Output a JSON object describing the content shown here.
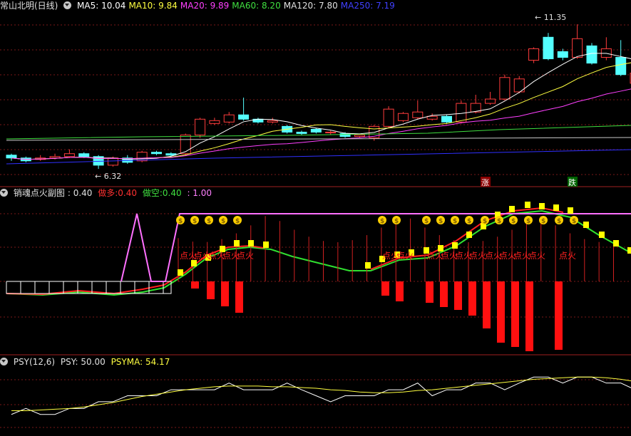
{
  "main": {
    "title": "常山北明(日线)",
    "ma": [
      {
        "label": "MA5: ",
        "value": "10.04",
        "color": "#ffffff"
      },
      {
        "label": "MA10: ",
        "value": "9.84",
        "color": "#ffff40"
      },
      {
        "label": "MA20: ",
        "value": "9.89",
        "color": "#ff40ff"
      },
      {
        "label": "MA60: ",
        "value": "8.20",
        "color": "#40e040"
      },
      {
        "label": "MA120: ",
        "value": "7.80",
        "color": "#e0e0e0"
      },
      {
        "label": "MA250: ",
        "value": "7.19",
        "color": "#4040ff"
      }
    ],
    "high_label": "11.35",
    "low_label": "6.32",
    "badge_up": "涨",
    "badge_down": "跌"
  },
  "indicator": {
    "title": "销魂点火副图",
    "value": "0.40",
    "long_label": "做多:",
    "long_value": "0.40",
    "short_label": "做空:",
    "short_value": "0.40",
    "extra": ": 1.00",
    "fire_text": "点火",
    "coin_text": "$"
  },
  "psy": {
    "title": "PSY(12,6)",
    "psy_label": "PSY: ",
    "psy_value": "50.00",
    "psyma_label": "PSYMA: ",
    "psyma_value": "54.17"
  },
  "chart_data": {
    "type": "candlestick",
    "candles": [
      {
        "o": 6.8,
        "c": 6.7,
        "h": 6.85,
        "l": 6.6
      },
      {
        "o": 6.7,
        "c": 6.6,
        "h": 6.75,
        "l": 6.55
      },
      {
        "o": 6.65,
        "c": 6.7,
        "h": 6.8,
        "l": 6.6
      },
      {
        "o": 6.7,
        "c": 6.75,
        "h": 6.85,
        "l": 6.65
      },
      {
        "o": 6.75,
        "c": 6.85,
        "h": 7.0,
        "l": 6.7
      },
      {
        "o": 6.85,
        "c": 6.75,
        "h": 6.9,
        "l": 6.7
      },
      {
        "o": 6.75,
        "c": 6.45,
        "h": 6.8,
        "l": 6.32
      },
      {
        "o": 6.45,
        "c": 6.7,
        "h": 6.75,
        "l": 6.4
      },
      {
        "o": 6.7,
        "c": 6.55,
        "h": 6.8,
        "l": 6.5
      },
      {
        "o": 6.6,
        "c": 6.9,
        "h": 6.95,
        "l": 6.55
      },
      {
        "o": 6.9,
        "c": 6.85,
        "h": 6.95,
        "l": 6.8
      },
      {
        "o": 6.85,
        "c": 6.8,
        "h": 6.9,
        "l": 6.75
      },
      {
        "o": 6.85,
        "c": 7.5,
        "h": 7.55,
        "l": 6.8
      },
      {
        "o": 7.5,
        "c": 8.05,
        "h": 8.1,
        "l": 7.4
      },
      {
        "o": 7.9,
        "c": 8.0,
        "h": 8.1,
        "l": 7.85
      },
      {
        "o": 7.95,
        "c": 8.2,
        "h": 8.3,
        "l": 7.9
      },
      {
        "o": 8.2,
        "c": 8.05,
        "h": 8.8,
        "l": 8.0
      },
      {
        "o": 8.05,
        "c": 7.95,
        "h": 8.1,
        "l": 7.9
      },
      {
        "o": 7.95,
        "c": 8.0,
        "h": 8.1,
        "l": 7.9
      },
      {
        "o": 7.8,
        "c": 7.6,
        "h": 7.85,
        "l": 7.55
      },
      {
        "o": 7.6,
        "c": 7.55,
        "h": 7.65,
        "l": 7.5
      },
      {
        "o": 7.7,
        "c": 7.6,
        "h": 7.75,
        "l": 7.55
      },
      {
        "o": 7.6,
        "c": 7.6,
        "h": 7.65,
        "l": 7.5
      },
      {
        "o": 7.55,
        "c": 7.45,
        "h": 7.6,
        "l": 7.4
      },
      {
        "o": 7.45,
        "c": 7.5,
        "h": 7.55,
        "l": 7.4
      },
      {
        "o": 7.4,
        "c": 7.8,
        "h": 7.85,
        "l": 7.3
      },
      {
        "o": 7.8,
        "c": 8.4,
        "h": 8.5,
        "l": 7.75
      },
      {
        "o": 8.0,
        "c": 8.25,
        "h": 8.3,
        "l": 7.95
      },
      {
        "o": 8.1,
        "c": 8.3,
        "h": 8.7,
        "l": 8.05
      },
      {
        "o": 8.05,
        "c": 8.15,
        "h": 8.25,
        "l": 8.0
      },
      {
        "o": 8.15,
        "c": 7.95,
        "h": 8.2,
        "l": 7.9
      },
      {
        "o": 7.95,
        "c": 8.6,
        "h": 8.7,
        "l": 7.9
      },
      {
        "o": 8.3,
        "c": 8.6,
        "h": 8.9,
        "l": 8.25
      },
      {
        "o": 8.6,
        "c": 8.75,
        "h": 9.0,
        "l": 8.55
      },
      {
        "o": 8.75,
        "c": 9.5,
        "h": 9.6,
        "l": 8.7
      },
      {
        "o": 9.0,
        "c": 9.45,
        "h": 9.55,
        "l": 8.95
      },
      {
        "o": 10.1,
        "c": 10.5,
        "h": 10.55,
        "l": 10.0
      },
      {
        "o": 10.9,
        "c": 10.15,
        "h": 11.05,
        "l": 10.1
      },
      {
        "o": 10.4,
        "c": 10.2,
        "h": 10.5,
        "l": 10.1
      },
      {
        "o": 10.2,
        "c": 10.85,
        "h": 11.35,
        "l": 10.15
      },
      {
        "o": 10.6,
        "c": 10.0,
        "h": 10.7,
        "l": 9.95
      },
      {
        "o": 10.2,
        "c": 10.5,
        "h": 10.9,
        "l": 10.1
      },
      {
        "o": 10.2,
        "c": 9.6,
        "h": 10.8,
        "l": 9.55
      },
      {
        "o": 9.3,
        "c": 9.65,
        "h": 10.1,
        "l": 9.25
      },
      {
        "o": 9.5,
        "c": 9.75,
        "h": 9.9,
        "l": 9.45
      },
      {
        "o": 9.65,
        "c": 9.7,
        "h": 9.75,
        "l": 9.2
      },
      {
        "o": 9.7,
        "c": 9.95,
        "h": 10.0,
        "l": 9.65
      }
    ],
    "psy": [
      25,
      33,
      25,
      25,
      33,
      33,
      42,
      42,
      50,
      50,
      50,
      58,
      58,
      58,
      58,
      67,
      58,
      58,
      58,
      67,
      58,
      50,
      42,
      50,
      50,
      50,
      58,
      58,
      67,
      50,
      58,
      58,
      67,
      67,
      58,
      67,
      75,
      75,
      67,
      75,
      75,
      67,
      67,
      58,
      58,
      58,
      50
    ],
    "psyma": [
      30,
      30,
      31,
      32,
      33,
      35,
      38,
      41,
      45,
      49,
      52,
      55,
      58,
      60,
      62,
      63,
      63,
      63,
      62,
      62,
      61,
      60,
      58,
      57,
      55,
      54,
      54,
      55,
      57,
      58,
      60,
      62,
      64,
      66,
      68,
      70,
      72,
      73,
      74,
      75,
      75,
      74,
      72,
      69,
      65,
      60,
      54.17
    ]
  }
}
